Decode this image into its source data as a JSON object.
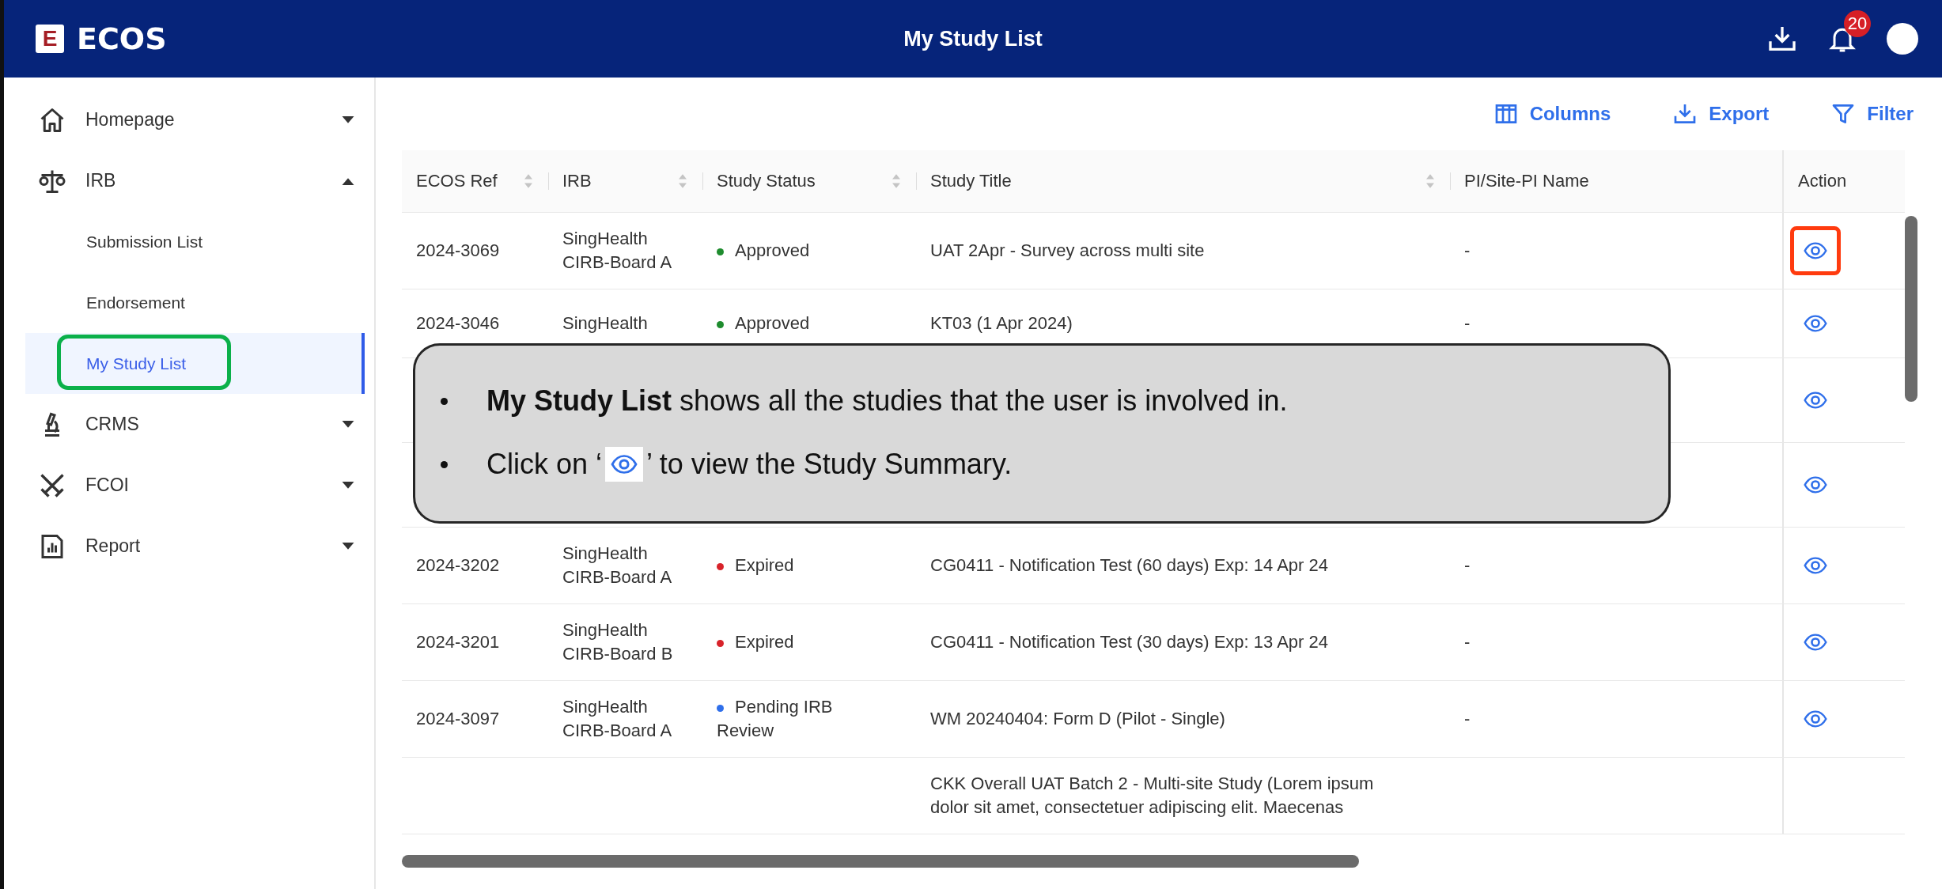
{
  "app": {
    "logo_mark": "E",
    "name": "ECOS"
  },
  "page_title": "My Study List",
  "notifications": {
    "count": "20"
  },
  "sidebar": {
    "items": [
      {
        "label": "Homepage",
        "expanded": false
      },
      {
        "label": "IRB",
        "expanded": true,
        "children": [
          {
            "label": "Submission List",
            "selected": false,
            "annotated": false
          },
          {
            "label": "Endorsement",
            "selected": false,
            "annotated": false
          },
          {
            "label": "My Study List",
            "selected": true,
            "annotated": true
          }
        ]
      },
      {
        "label": "CRMS",
        "expanded": false
      },
      {
        "label": "FCOI",
        "expanded": false
      },
      {
        "label": "Report",
        "expanded": false
      }
    ]
  },
  "toolbar": [
    "Columns",
    "Export",
    "Filter"
  ],
  "table": {
    "columns": [
      {
        "label": "ECOS Ref",
        "sortable": true
      },
      {
        "label": "IRB",
        "sortable": true
      },
      {
        "label": "Study Status",
        "sortable": true
      },
      {
        "label": "Study Title",
        "sortable": true
      },
      {
        "label": "PI/Site-PI Name",
        "sortable": false
      },
      {
        "label": "Action",
        "sortable": false
      }
    ],
    "rows": [
      {
        "ecos_ref": "2024-3069",
        "irb": "SingHealth CIRB-Board A",
        "status": {
          "label": "Approved",
          "color": "#1e8c2e"
        },
        "title": "UAT 2Apr - Survey across multi site",
        "pi": "-",
        "view": true,
        "annotated": true
      },
      {
        "ecos_ref": "2024-3046",
        "irb": "SingHealth",
        "status": {
          "label": "Approved",
          "color": "#1e8c2e"
        },
        "title": "KT03 (1 Apr 2024)",
        "pi": "-",
        "view": true
      },
      {
        "view": true
      },
      {
        "view": true
      },
      {
        "ecos_ref": "2024-3202",
        "irb": "SingHealth CIRB-Board A",
        "status": {
          "label": "Expired",
          "color": "#d8232a"
        },
        "title": "CG0411 - Notification Test (60 days) Exp: 14 Apr 24",
        "pi": "-",
        "view": true
      },
      {
        "ecos_ref": "2024-3201",
        "irb": "SingHealth CIRB-Board B",
        "status": {
          "label": "Expired",
          "color": "#d8232a"
        },
        "title": "CG0411 - Notification Test (30 days) Exp: 13 Apr 24",
        "pi": "-",
        "view": true
      },
      {
        "ecos_ref": "2024-3097",
        "irb": "SingHealth CIRB-Board A",
        "status": {
          "label": "Pending IRB Review",
          "color": "#2f6fea"
        },
        "title": "WM 20240404: Form D (Pilot - Single)",
        "pi": "-",
        "view": true
      },
      {
        "title": "CKK Overall UAT Batch 2 - Multi-site Study (Lorem ipsum dolor sit amet, consectetuer adipiscing elit. Maecenas"
      }
    ]
  },
  "callout": {
    "lines": [
      {
        "text": "**My Study List** shows all the studies that the user is involved in."
      },
      {
        "before": "Click on ‘",
        "after": "’ to view the Study Summary."
      }
    ]
  }
}
